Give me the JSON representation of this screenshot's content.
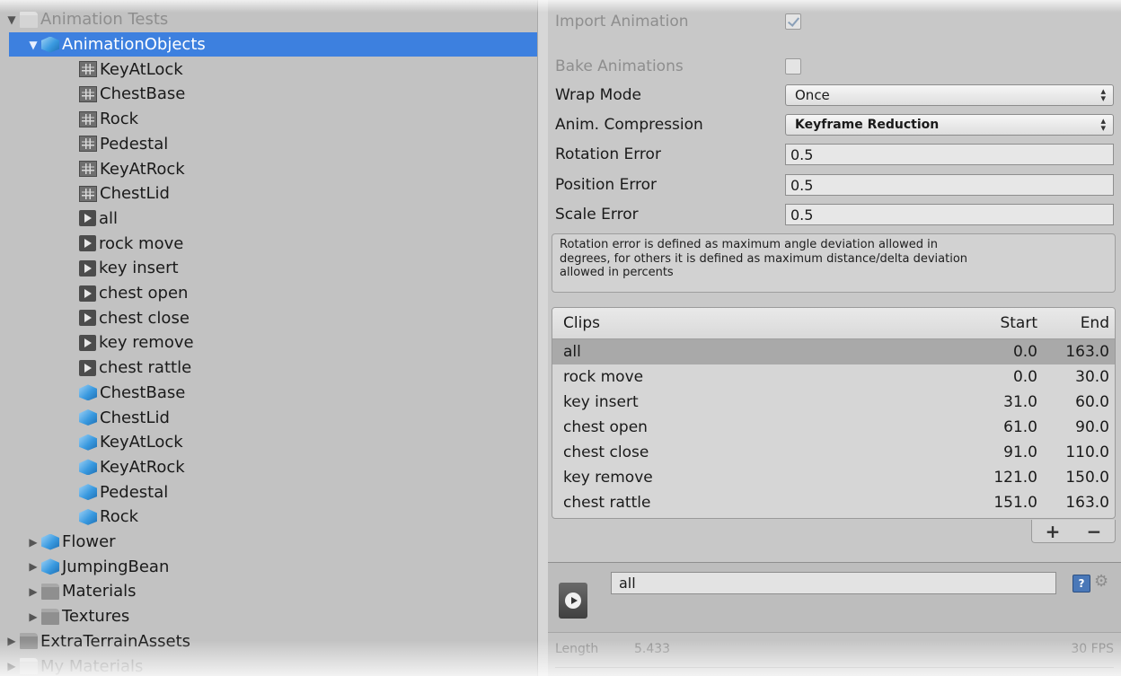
{
  "project_tree": {
    "items": [
      {
        "label": "Animation Tests",
        "icon": "folder-icon",
        "depth": 0,
        "expanded": true,
        "faded": true
      },
      {
        "label": "AnimationObjects",
        "icon": "prefab-icon",
        "depth": 1,
        "expanded": true,
        "selected": true
      },
      {
        "label": "KeyAtLock",
        "icon": "mesh-icon",
        "depth": 2
      },
      {
        "label": "ChestBase",
        "icon": "mesh-icon",
        "depth": 2
      },
      {
        "label": "Rock",
        "icon": "mesh-icon",
        "depth": 2
      },
      {
        "label": "Pedestal",
        "icon": "mesh-icon",
        "depth": 2
      },
      {
        "label": "KeyAtRock",
        "icon": "mesh-icon",
        "depth": 2
      },
      {
        "label": "ChestLid",
        "icon": "mesh-icon",
        "depth": 2
      },
      {
        "label": "all",
        "icon": "animation-clip-icon",
        "depth": 2
      },
      {
        "label": "rock move",
        "icon": "animation-clip-icon",
        "depth": 2
      },
      {
        "label": "key insert",
        "icon": "animation-clip-icon",
        "depth": 2
      },
      {
        "label": "chest open",
        "icon": "animation-clip-icon",
        "depth": 2
      },
      {
        "label": "chest close",
        "icon": "animation-clip-icon",
        "depth": 2
      },
      {
        "label": "key remove",
        "icon": "animation-clip-icon",
        "depth": 2
      },
      {
        "label": "chest rattle",
        "icon": "animation-clip-icon",
        "depth": 2
      },
      {
        "label": "ChestBase",
        "icon": "prefab-icon",
        "depth": 2
      },
      {
        "label": "ChestLid",
        "icon": "prefab-icon",
        "depth": 2
      },
      {
        "label": "KeyAtLock",
        "icon": "prefab-icon",
        "depth": 2
      },
      {
        "label": "KeyAtRock",
        "icon": "prefab-icon",
        "depth": 2
      },
      {
        "label": "Pedestal",
        "icon": "prefab-icon",
        "depth": 2
      },
      {
        "label": "Rock",
        "icon": "prefab-icon",
        "depth": 2
      },
      {
        "label": "Flower",
        "icon": "prefab-icon",
        "depth": 1,
        "collapsed": true
      },
      {
        "label": "JumpingBean",
        "icon": "prefab-icon",
        "depth": 1,
        "collapsed": true
      },
      {
        "label": "Materials",
        "icon": "folder-icon",
        "depth": 1,
        "collapsed": true
      },
      {
        "label": "Textures",
        "icon": "folder-icon",
        "depth": 1,
        "collapsed": true
      },
      {
        "label": "ExtraTerrainAssets",
        "icon": "folder-icon",
        "depth": 0,
        "collapsed": true
      },
      {
        "label": "My Materials",
        "icon": "folder-icon",
        "depth": 0,
        "collapsed": true,
        "faded": true
      }
    ]
  },
  "inspector": {
    "import_animation": {
      "label": "Import Animation",
      "checked": true
    },
    "bake_animations": {
      "label": "Bake Animations",
      "checked": false
    },
    "wrap_mode": {
      "label": "Wrap Mode",
      "value": "Once"
    },
    "anim_compression": {
      "label": "Anim. Compression",
      "value": "Keyframe Reduction"
    },
    "rotation_error": {
      "label": "Rotation Error",
      "value": "0.5"
    },
    "position_error": {
      "label": "Position Error",
      "value": "0.5"
    },
    "scale_error": {
      "label": "Scale Error",
      "value": "0.5"
    },
    "help_lines": [
      "Rotation error is defined as maximum angle deviation allowed in",
      "degrees, for others it is defined as maximum distance/delta deviation",
      "allowed in percents"
    ],
    "clips": {
      "headers": {
        "name": "Clips",
        "start": "Start",
        "end": "End"
      },
      "rows": [
        {
          "name": "all",
          "start": "0.0",
          "end": "163.0",
          "selected": true
        },
        {
          "name": "rock move",
          "start": "0.0",
          "end": "30.0"
        },
        {
          "name": "key insert",
          "start": "31.0",
          "end": "60.0"
        },
        {
          "name": "chest open",
          "start": "61.0",
          "end": "90.0"
        },
        {
          "name": "chest close",
          "start": "91.0",
          "end": "110.0"
        },
        {
          "name": "key remove",
          "start": "121.0",
          "end": "150.0"
        },
        {
          "name": "chest rattle",
          "start": "151.0",
          "end": "163.0"
        }
      ],
      "add_label": "+",
      "remove_label": "−"
    },
    "preview": {
      "clip_name": "all",
      "help_glyph": "?",
      "gear_glyph": "⚙"
    },
    "timeline": {
      "length_label": "Length",
      "length_value": "5.433",
      "fps": "30 FPS"
    }
  },
  "colors": {
    "selection": "#3d80df",
    "panel": "#c2c2c2",
    "inspector": "#c8c8c8"
  }
}
